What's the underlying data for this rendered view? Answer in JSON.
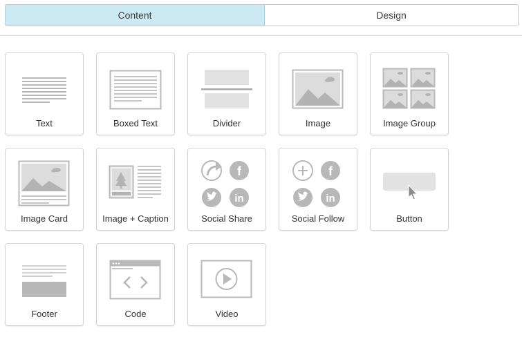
{
  "tabs": [
    {
      "label": "Content",
      "active": true
    },
    {
      "label": "Design",
      "active": false
    }
  ],
  "blocks": [
    {
      "label": "Text",
      "icon": "text-lines-icon"
    },
    {
      "label": "Boxed Text",
      "icon": "boxed-text-icon"
    },
    {
      "label": "Divider",
      "icon": "divider-icon"
    },
    {
      "label": "Image",
      "icon": "image-icon"
    },
    {
      "label": "Image Group",
      "icon": "image-group-icon"
    },
    {
      "label": "Image Card",
      "icon": "image-card-icon"
    },
    {
      "label": "Image + Caption",
      "icon": "image-caption-icon"
    },
    {
      "label": "Social Share",
      "icon": "social-share-icon"
    },
    {
      "label": "Social Follow",
      "icon": "social-follow-icon"
    },
    {
      "label": "Button",
      "icon": "button-block-icon"
    },
    {
      "label": "Footer",
      "icon": "footer-icon"
    },
    {
      "label": "Code",
      "icon": "code-icon"
    },
    {
      "label": "Video",
      "icon": "video-icon"
    }
  ],
  "colors": {
    "active_tab_bg": "#cdeaf3",
    "icon_gray": "#b8b8b8",
    "icon_light": "#e2e2e2",
    "icon_dark": "#a6a6a6"
  }
}
